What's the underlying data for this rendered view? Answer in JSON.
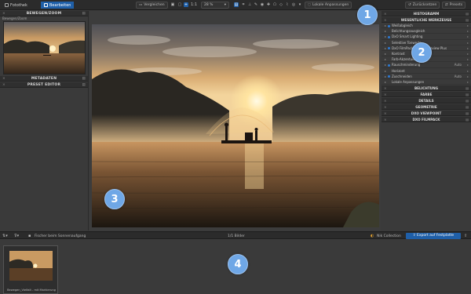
{
  "tabs": [
    {
      "label": "Fotothek",
      "active": false
    },
    {
      "label": "Bearbeiten",
      "active": true
    }
  ],
  "toolbar": {
    "compare_label": "Vergleichen",
    "zoom_ratio": "1:1",
    "zoom_level": "28 %",
    "local_adjust_label": "Lokale Anpassungen",
    "reset_label": "Zurücksetzen",
    "presets_label": "Presets"
  },
  "left_panel": {
    "navigator_title": "BEWEGEN/ZOOM",
    "navigator_sub": "Bewegen/Zoom",
    "metadata_title": "METADATEN",
    "preset_title": "PRESET EDITOR"
  },
  "right_panel": {
    "histogram_title": "HISTOGRAMM",
    "tools_title": "WESENTLICHE WERKZEUGE",
    "tools": [
      {
        "label": "Weißabgleich",
        "active": true,
        "value": ""
      },
      {
        "label": "Belichtungsausgleich",
        "active": false,
        "value": ""
      },
      {
        "label": "DxO Smart Lighting",
        "active": true,
        "value": ""
      },
      {
        "label": "Selektive Tonwerte",
        "active": false,
        "value": ""
      },
      {
        "label": "DxO FilmPack Vintage Preview Plus",
        "active": true,
        "value": ""
      },
      {
        "label": "Kontrast",
        "active": false,
        "value": ""
      },
      {
        "label": "Farb-Akzentuierung",
        "active": false,
        "value": ""
      },
      {
        "label": "Rauschminderung",
        "active": true,
        "value": "Auto"
      },
      {
        "label": "Horizont",
        "active": false,
        "value": ""
      },
      {
        "label": "Zuschneiden",
        "active": true,
        "value": "Auto"
      },
      {
        "label": "Lokale Anpassungen",
        "active": false,
        "value": ""
      }
    ],
    "sections": [
      "BELICHTUNG",
      "FARBE",
      "DETAILS",
      "GEOMETRIE",
      "DXO VIEWPOINT",
      "DXO FILMPACK"
    ]
  },
  "filmbar": {
    "preset_name": "Fischer beim Sonnenaufgang",
    "count": "1/1 Bilder",
    "collection": "Nik Collection",
    "export_label": "Export auf Festplatte"
  },
  "filmstrip": {
    "items": [
      {
        "caption": "Bewegen_Vielfalt - mit Markierung"
      }
    ]
  },
  "callouts": [
    "1",
    "2",
    "3",
    "4"
  ],
  "colors": {
    "accent": "#1f5fa8",
    "callout": "#6fa7e6"
  }
}
